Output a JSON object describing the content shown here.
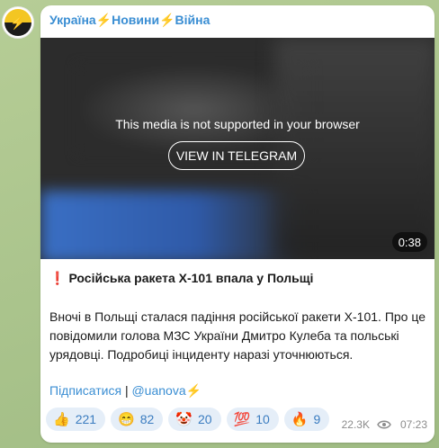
{
  "channel": {
    "name": "Україна⚡Новини⚡Війна",
    "avatar_icon": "ukraine-news-logo-icon"
  },
  "media": {
    "unsupported_text": "This media is not supported in your browser",
    "view_button_label": "VIEW IN TELEGRAM",
    "duration": "0:38"
  },
  "post": {
    "headline_icon": "❗",
    "headline": "Російська ракета Х-101 впала у Польщі",
    "body": "Вночі в Польщі сталася падіння російської ракети Х-101. Про це повідомили голова МЗС України Дмитро Кулеба та польські урядовці. Подробиці інциденту наразі уточнюються.",
    "subscribe_link": "Підписатися",
    "separator": "|",
    "handle_link": "@uanova⚡"
  },
  "reactions": [
    {
      "emoji": "👍",
      "count": "221"
    },
    {
      "emoji": "😁",
      "count": "82"
    },
    {
      "emoji": "🤡",
      "count": "20"
    },
    {
      "emoji": "💯",
      "count": "10"
    },
    {
      "emoji": "🔥",
      "count": "9"
    }
  ],
  "meta": {
    "views": "22.3K",
    "time": "07:23"
  },
  "colors": {
    "link": "#3a8ed3",
    "reaction_bg": "#e5eef8",
    "background": "#a9c28e"
  }
}
